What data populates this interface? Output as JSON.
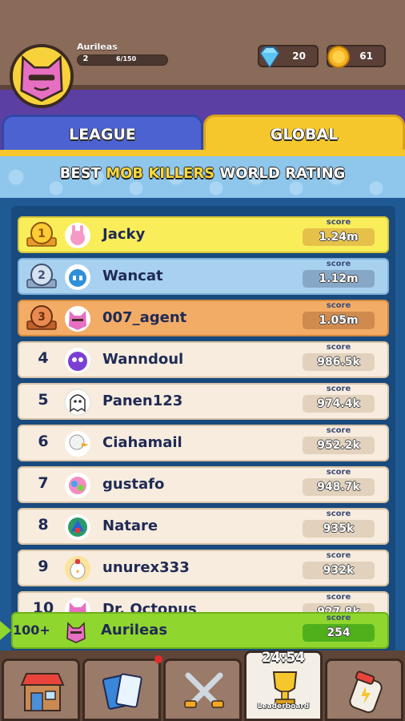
{
  "player": {
    "name": "Aurileas",
    "level": "2",
    "xp": "6/150"
  },
  "currency": {
    "gems": "20",
    "coins": "61"
  },
  "tabs": [
    {
      "label": "LEAGUE"
    },
    {
      "label": "GLOBAL"
    }
  ],
  "banner": {
    "prefix": "BEST ",
    "highlight": "MOB KILLERS",
    "suffix": " WORLD RATING"
  },
  "score_label": "score",
  "rows": [
    {
      "rank": "1",
      "name": "Jacky",
      "score": "1.24m"
    },
    {
      "rank": "2",
      "name": "Wancat",
      "score": "1.12m"
    },
    {
      "rank": "3",
      "name": "007_agent",
      "score": "1.05m"
    },
    {
      "rank": "4",
      "name": "Wanndoul",
      "score": "986.5k"
    },
    {
      "rank": "5",
      "name": "Panen123",
      "score": "974.4k"
    },
    {
      "rank": "6",
      "name": "Ciahamail",
      "score": "952.2k"
    },
    {
      "rank": "7",
      "name": "gustafo",
      "score": "948.7k"
    },
    {
      "rank": "8",
      "name": "Natare",
      "score": "935k"
    },
    {
      "rank": "9",
      "name": "unurex333",
      "score": "932k"
    },
    {
      "rank": "10",
      "name": "Dr. Octopus",
      "score": "927.8k"
    }
  ],
  "me_row": {
    "rank": "100+",
    "name": "Aurileas",
    "score": "254"
  },
  "nav": {
    "timer": "24:54",
    "leaderboard_label": "Leaderboard"
  },
  "icons": {
    "gem": "diamond-icon",
    "coin": "coin-icon",
    "shop": "shop-icon",
    "cards": "cards-icon",
    "battle": "crossed-swords-icon",
    "leaderboard": "trophy-icon",
    "potion": "potion-icon"
  }
}
